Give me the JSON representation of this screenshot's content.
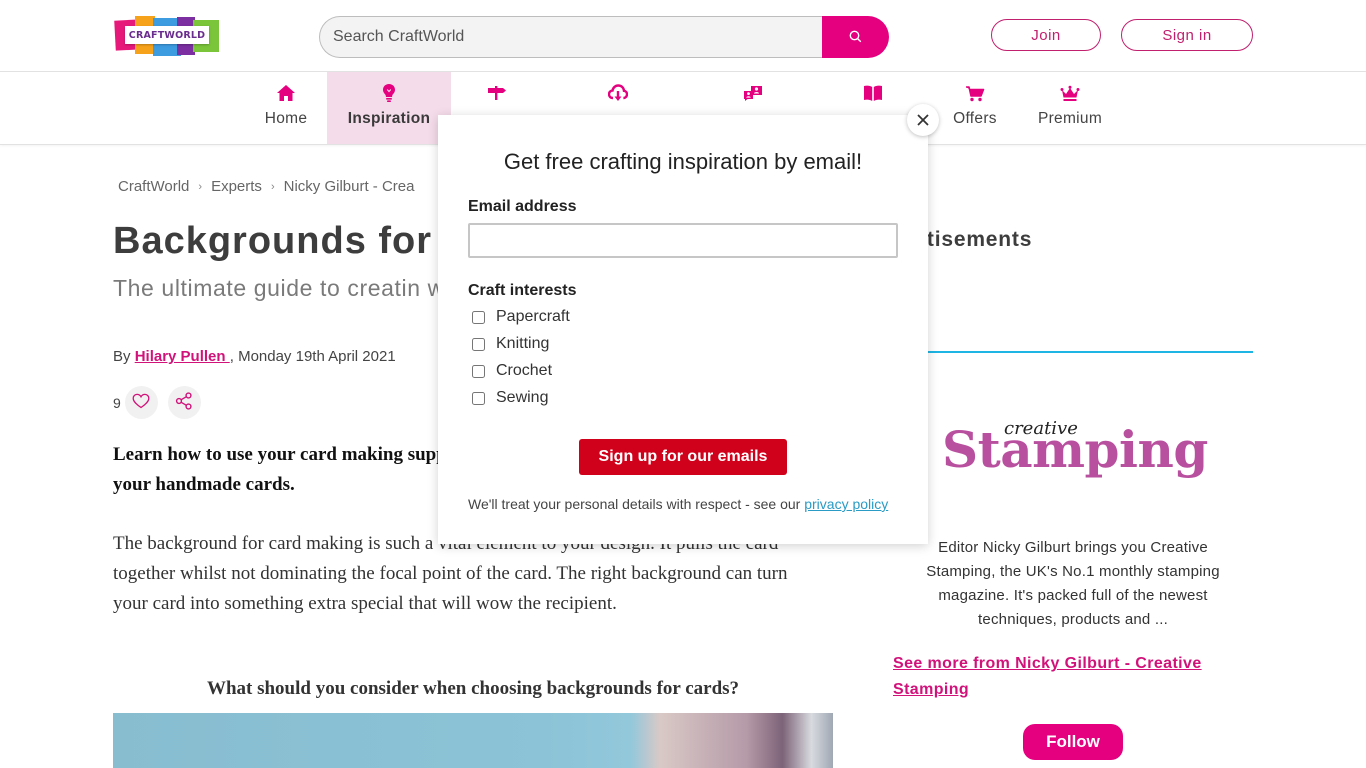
{
  "header": {
    "logo_text": "CRAFTWORLD",
    "search_placeholder": "Search CraftWorld",
    "search_value": "",
    "join_label": "Join",
    "signin_label": "Sign in"
  },
  "nav": {
    "items": [
      {
        "label": "Home",
        "icon": "home-icon",
        "active": false
      },
      {
        "label": "Inspiration",
        "icon": "lightbulb-icon",
        "active": true
      },
      {
        "label": "",
        "icon": "signpost-icon",
        "active": false
      },
      {
        "label": "",
        "icon": "cloud-download-icon",
        "active": false
      },
      {
        "label": "",
        "icon": "community-icon",
        "active": false
      },
      {
        "label": "",
        "icon": "book-icon",
        "active": false
      },
      {
        "label": "Offers",
        "icon": "cart-icon",
        "active": false
      },
      {
        "label": "Premium",
        "icon": "crown-icon",
        "active": false
      }
    ]
  },
  "breadcrumb": {
    "items": [
      "CraftWorld",
      "Experts",
      "Nicky Gilburt - Crea"
    ]
  },
  "article": {
    "title": "Backgrounds for C",
    "subtitle": "The ultimate guide to creatin with step-by-step tutorials for",
    "byline_prefix": "By ",
    "author": "Hilary Pullen ",
    "date": ", Monday 19th April 2021",
    "like_count": "9",
    "lead": "Learn how to use your card making supp your handmade cards.",
    "lead_line1": "Learn how to use your card making supp",
    "lead_line2": "your handmade cards.",
    "body_line1": "The background for card making is such a vital element to your design. It pulls the card",
    "body_line2": "together whilst not dominating the focal point of the card. The right background can turn",
    "body_line3": "your card into something extra special that will wow the recipient.",
    "heading": "What should you consider when choosing backgrounds for cards?"
  },
  "sidebar": {
    "title": "vertisements",
    "logo_small": "creative",
    "logo_large": "Stamping",
    "description": "Editor Nicky Gilburt brings you Creative Stamping, the UK's No.1 monthly stamping magazine. It's packed full of the newest techniques, products and ...",
    "see_more": "See more from Nicky Gilburt - Creative Stamping",
    "follow_label": "Follow"
  },
  "modal": {
    "title": "Get free crafting inspiration by email!",
    "email_label": "Email address",
    "email_value": "",
    "interests_label": "Craft interests",
    "interests": [
      {
        "label": "Papercraft",
        "checked": false
      },
      {
        "label": "Knitting",
        "checked": false
      },
      {
        "label": "Crochet",
        "checked": false
      },
      {
        "label": "Sewing",
        "checked": false
      }
    ],
    "submit_label": "Sign up for our emails",
    "privacy_text": "We'll treat your personal details with respect - see our ",
    "privacy_link": "privacy policy"
  },
  "colors": {
    "brand": "#e4007f",
    "accent_link": "#d1127a",
    "modal_button": "#d0021b",
    "sidebar_rule": "#1eb4e3",
    "nav_active_bg": "#f5dcea"
  }
}
